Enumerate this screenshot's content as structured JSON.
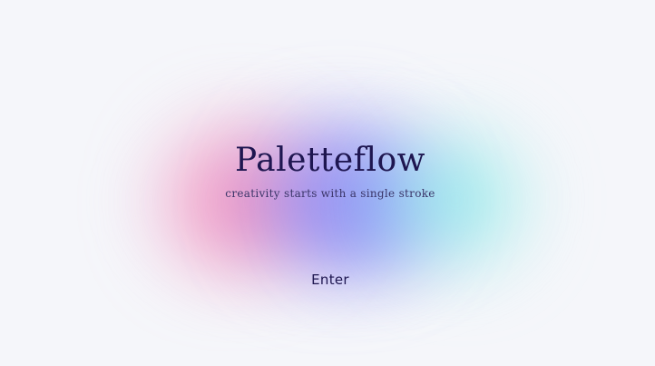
{
  "app": {
    "title": "Paletteflow",
    "tagline": "creativity starts with a single stroke"
  },
  "actions": {
    "enter_label": "Enter"
  },
  "colors": {
    "background": "#f5f6fa",
    "text": "#1e1650",
    "blob_pink": "#f56ea5",
    "blob_violet": "#7d69f0",
    "blob_blue": "#7896fa",
    "blob_cyan": "#78ebe6"
  }
}
